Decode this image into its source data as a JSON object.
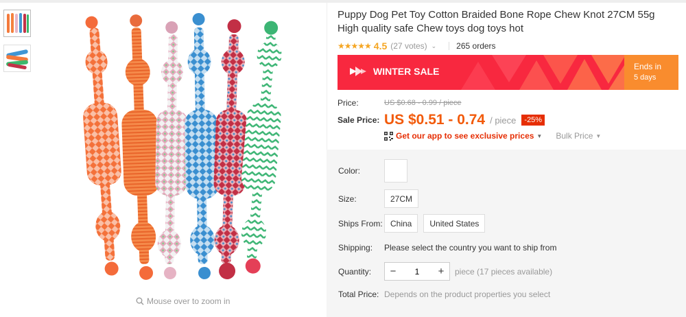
{
  "gallery": {
    "zoom_hint": "Mouse over to zoom in",
    "thumbnails": [
      "thumbnail-1",
      "thumbnail-2"
    ]
  },
  "product": {
    "title": "Puppy Dog Pet Toy Cotton Braided Bone Rope Chew Knot 27CM 55g High quality safe Chew toys dog toys hot",
    "rating": "4.5",
    "stars": "★★★★★",
    "votes": "(27 votes)",
    "orders": "265 orders"
  },
  "banner": {
    "sale_text": "WINTER SALE",
    "ends_label": "Ends in",
    "ends_value": "5 days",
    "colors": {
      "red": "#f8283f",
      "orange": "#f98c2e"
    }
  },
  "price": {
    "price_label": "Price:",
    "original": "US $0.68 - 0.99 / piece",
    "sale_label": "Sale Price:",
    "sale": "US $0.51 - 0.74",
    "per_piece": "/ piece",
    "discount": "-25%",
    "app_promo": "Get our app to see exclusive prices",
    "bulk_price": "Bulk Price"
  },
  "options": {
    "color_label": "Color:",
    "size_label": "Size:",
    "size_value": "27CM",
    "ships_from_label": "Ships From:",
    "ships_from": [
      "China",
      "United States"
    ],
    "shipping_label": "Shipping:",
    "shipping_text": "Please select the country you want to ship from",
    "quantity_label": "Quantity:",
    "quantity_value": "1",
    "quantity_minus": "−",
    "quantity_plus": "+",
    "availability": "piece (17 pieces available)",
    "total_label": "Total Price:",
    "total_text": "Depends on the product properties you select"
  }
}
